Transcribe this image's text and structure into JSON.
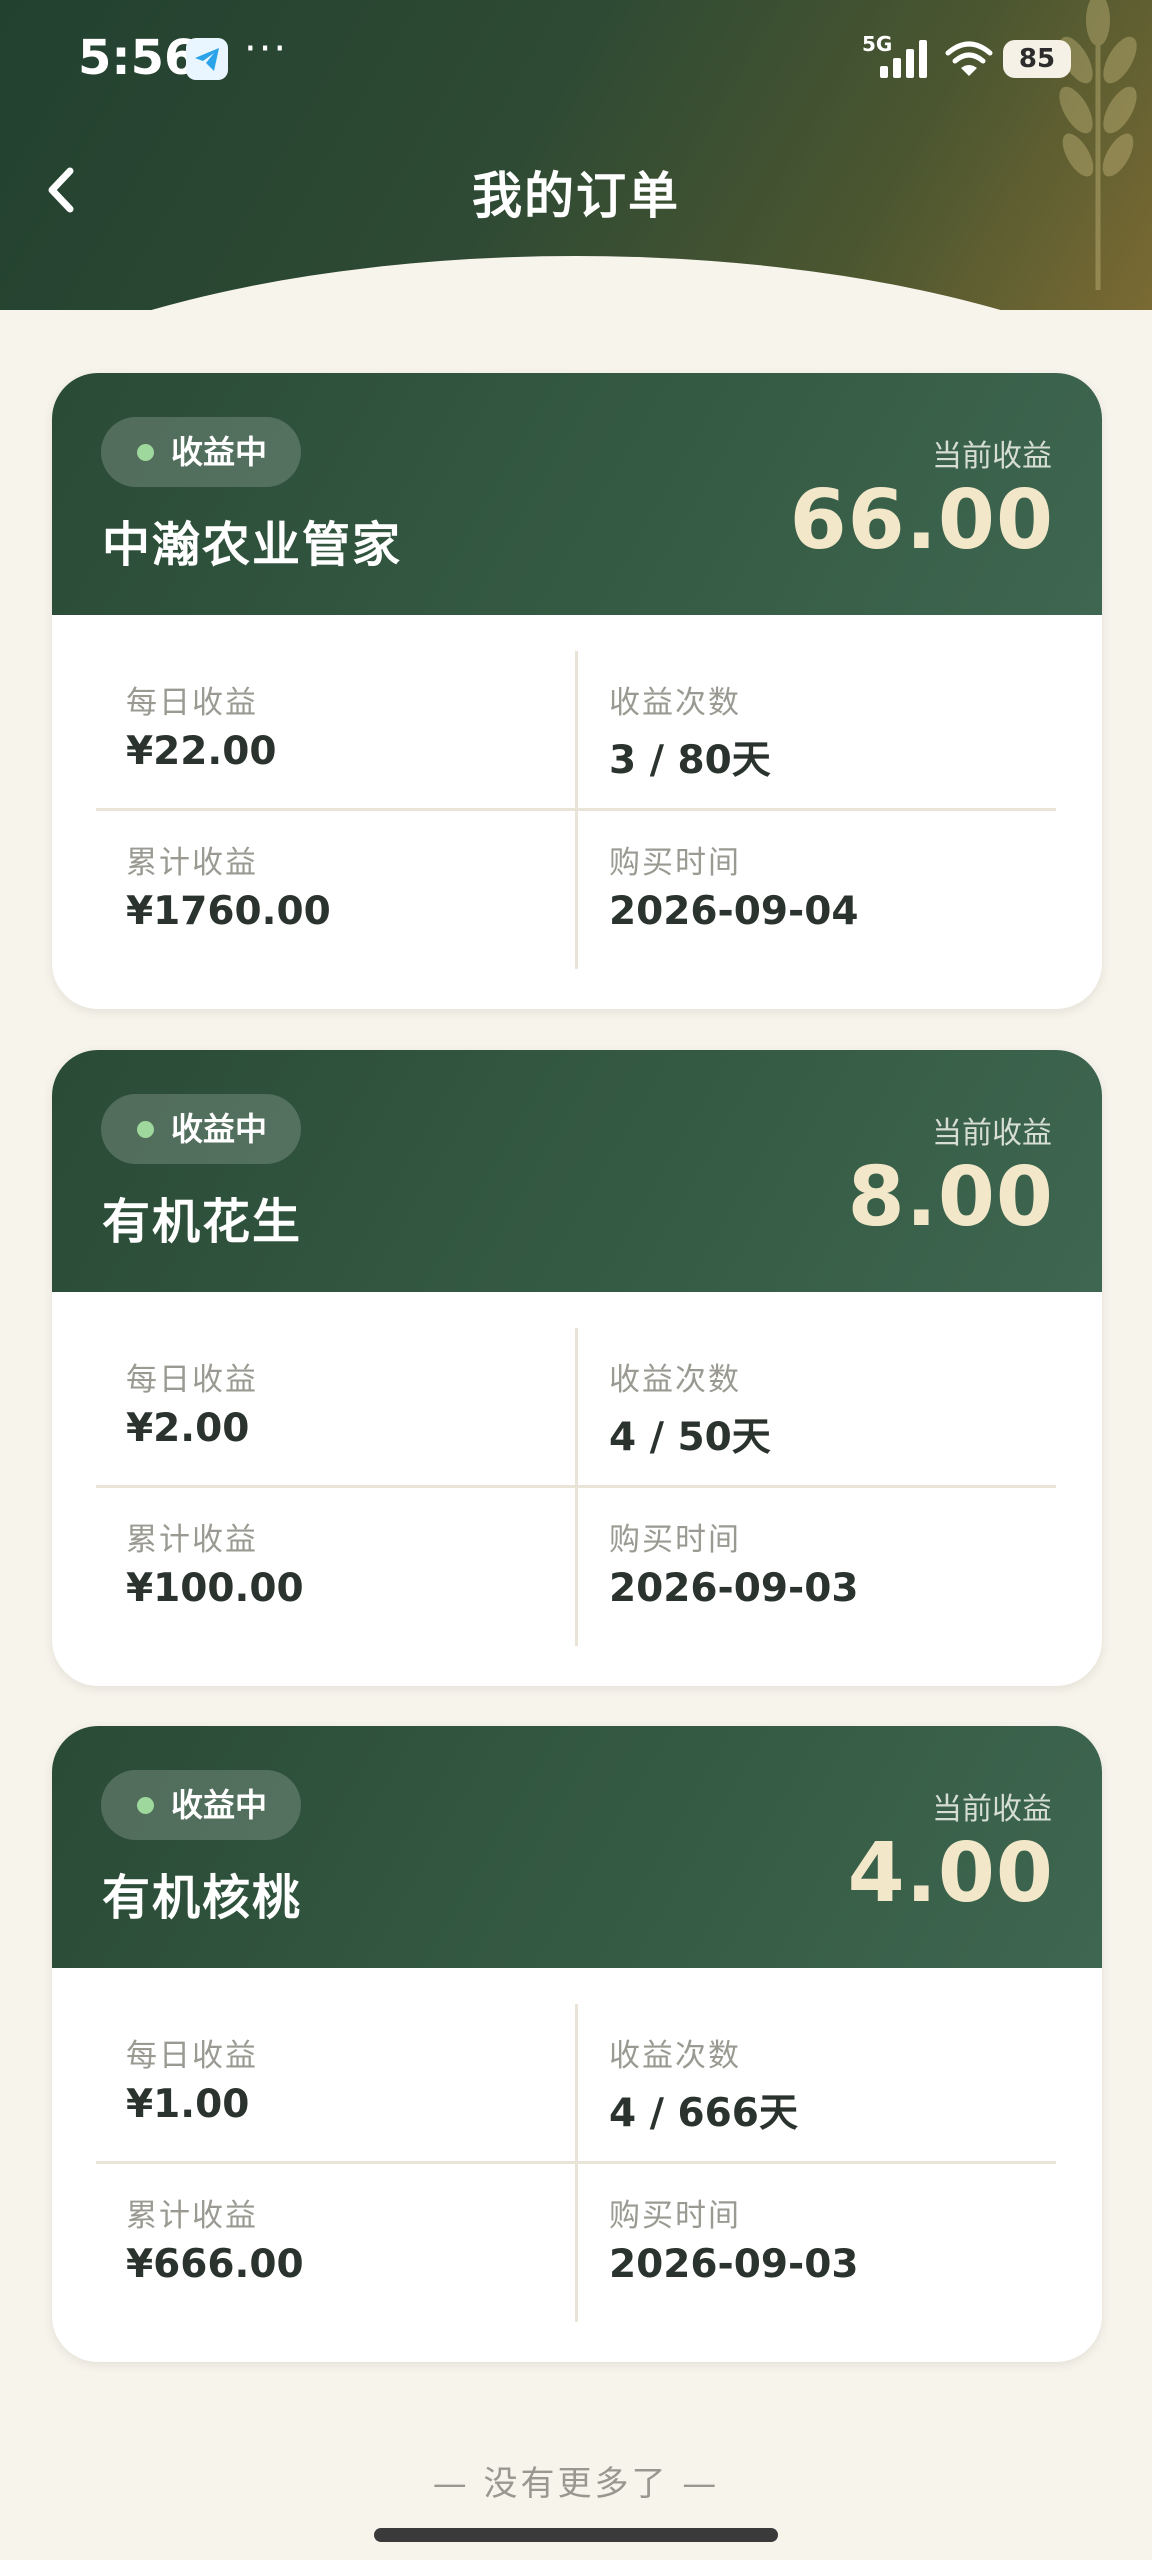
{
  "status_bar": {
    "time": "5:56",
    "dots": "···",
    "network": "5G",
    "battery": "85"
  },
  "header": {
    "title": "我的订单",
    "back_icon": "chevron-left-icon"
  },
  "orders": [
    {
      "status": "收益中",
      "name": "中瀚农业管家",
      "current_earnings_label": "当前收益",
      "current_earnings": "66.00",
      "daily_label": "每日收益",
      "daily": "¥22.00",
      "count_label": "收益次数",
      "count": "3 / 80天",
      "total_label": "累计收益",
      "total": "¥1760.00",
      "date_label": "购买时间",
      "date": "2026-09-04"
    },
    {
      "status": "收益中",
      "name": "有机花生",
      "current_earnings_label": "当前收益",
      "current_earnings": "8.00",
      "daily_label": "每日收益",
      "daily": "¥2.00",
      "count_label": "收益次数",
      "count": "4 / 50天",
      "total_label": "累计收益",
      "total": "¥100.00",
      "date_label": "购买时间",
      "date": "2026-09-03"
    },
    {
      "status": "收益中",
      "name": "有机核桃",
      "current_earnings_label": "当前收益",
      "current_earnings": "4.00",
      "daily_label": "每日收益",
      "daily": "¥1.00",
      "count_label": "收益次数",
      "count": "4 / 666天",
      "total_label": "累计收益",
      "total": "¥666.00",
      "date_label": "购买时间",
      "date": "2026-09-03"
    }
  ],
  "footer": {
    "no_more": "— 没有更多了 —"
  },
  "colors": {
    "header_dark": "#22412f",
    "card_head": "#355a43",
    "earn_value": "#f3e7c9",
    "badge_dot": "#9fd89c",
    "background": "#f7f4ec"
  }
}
